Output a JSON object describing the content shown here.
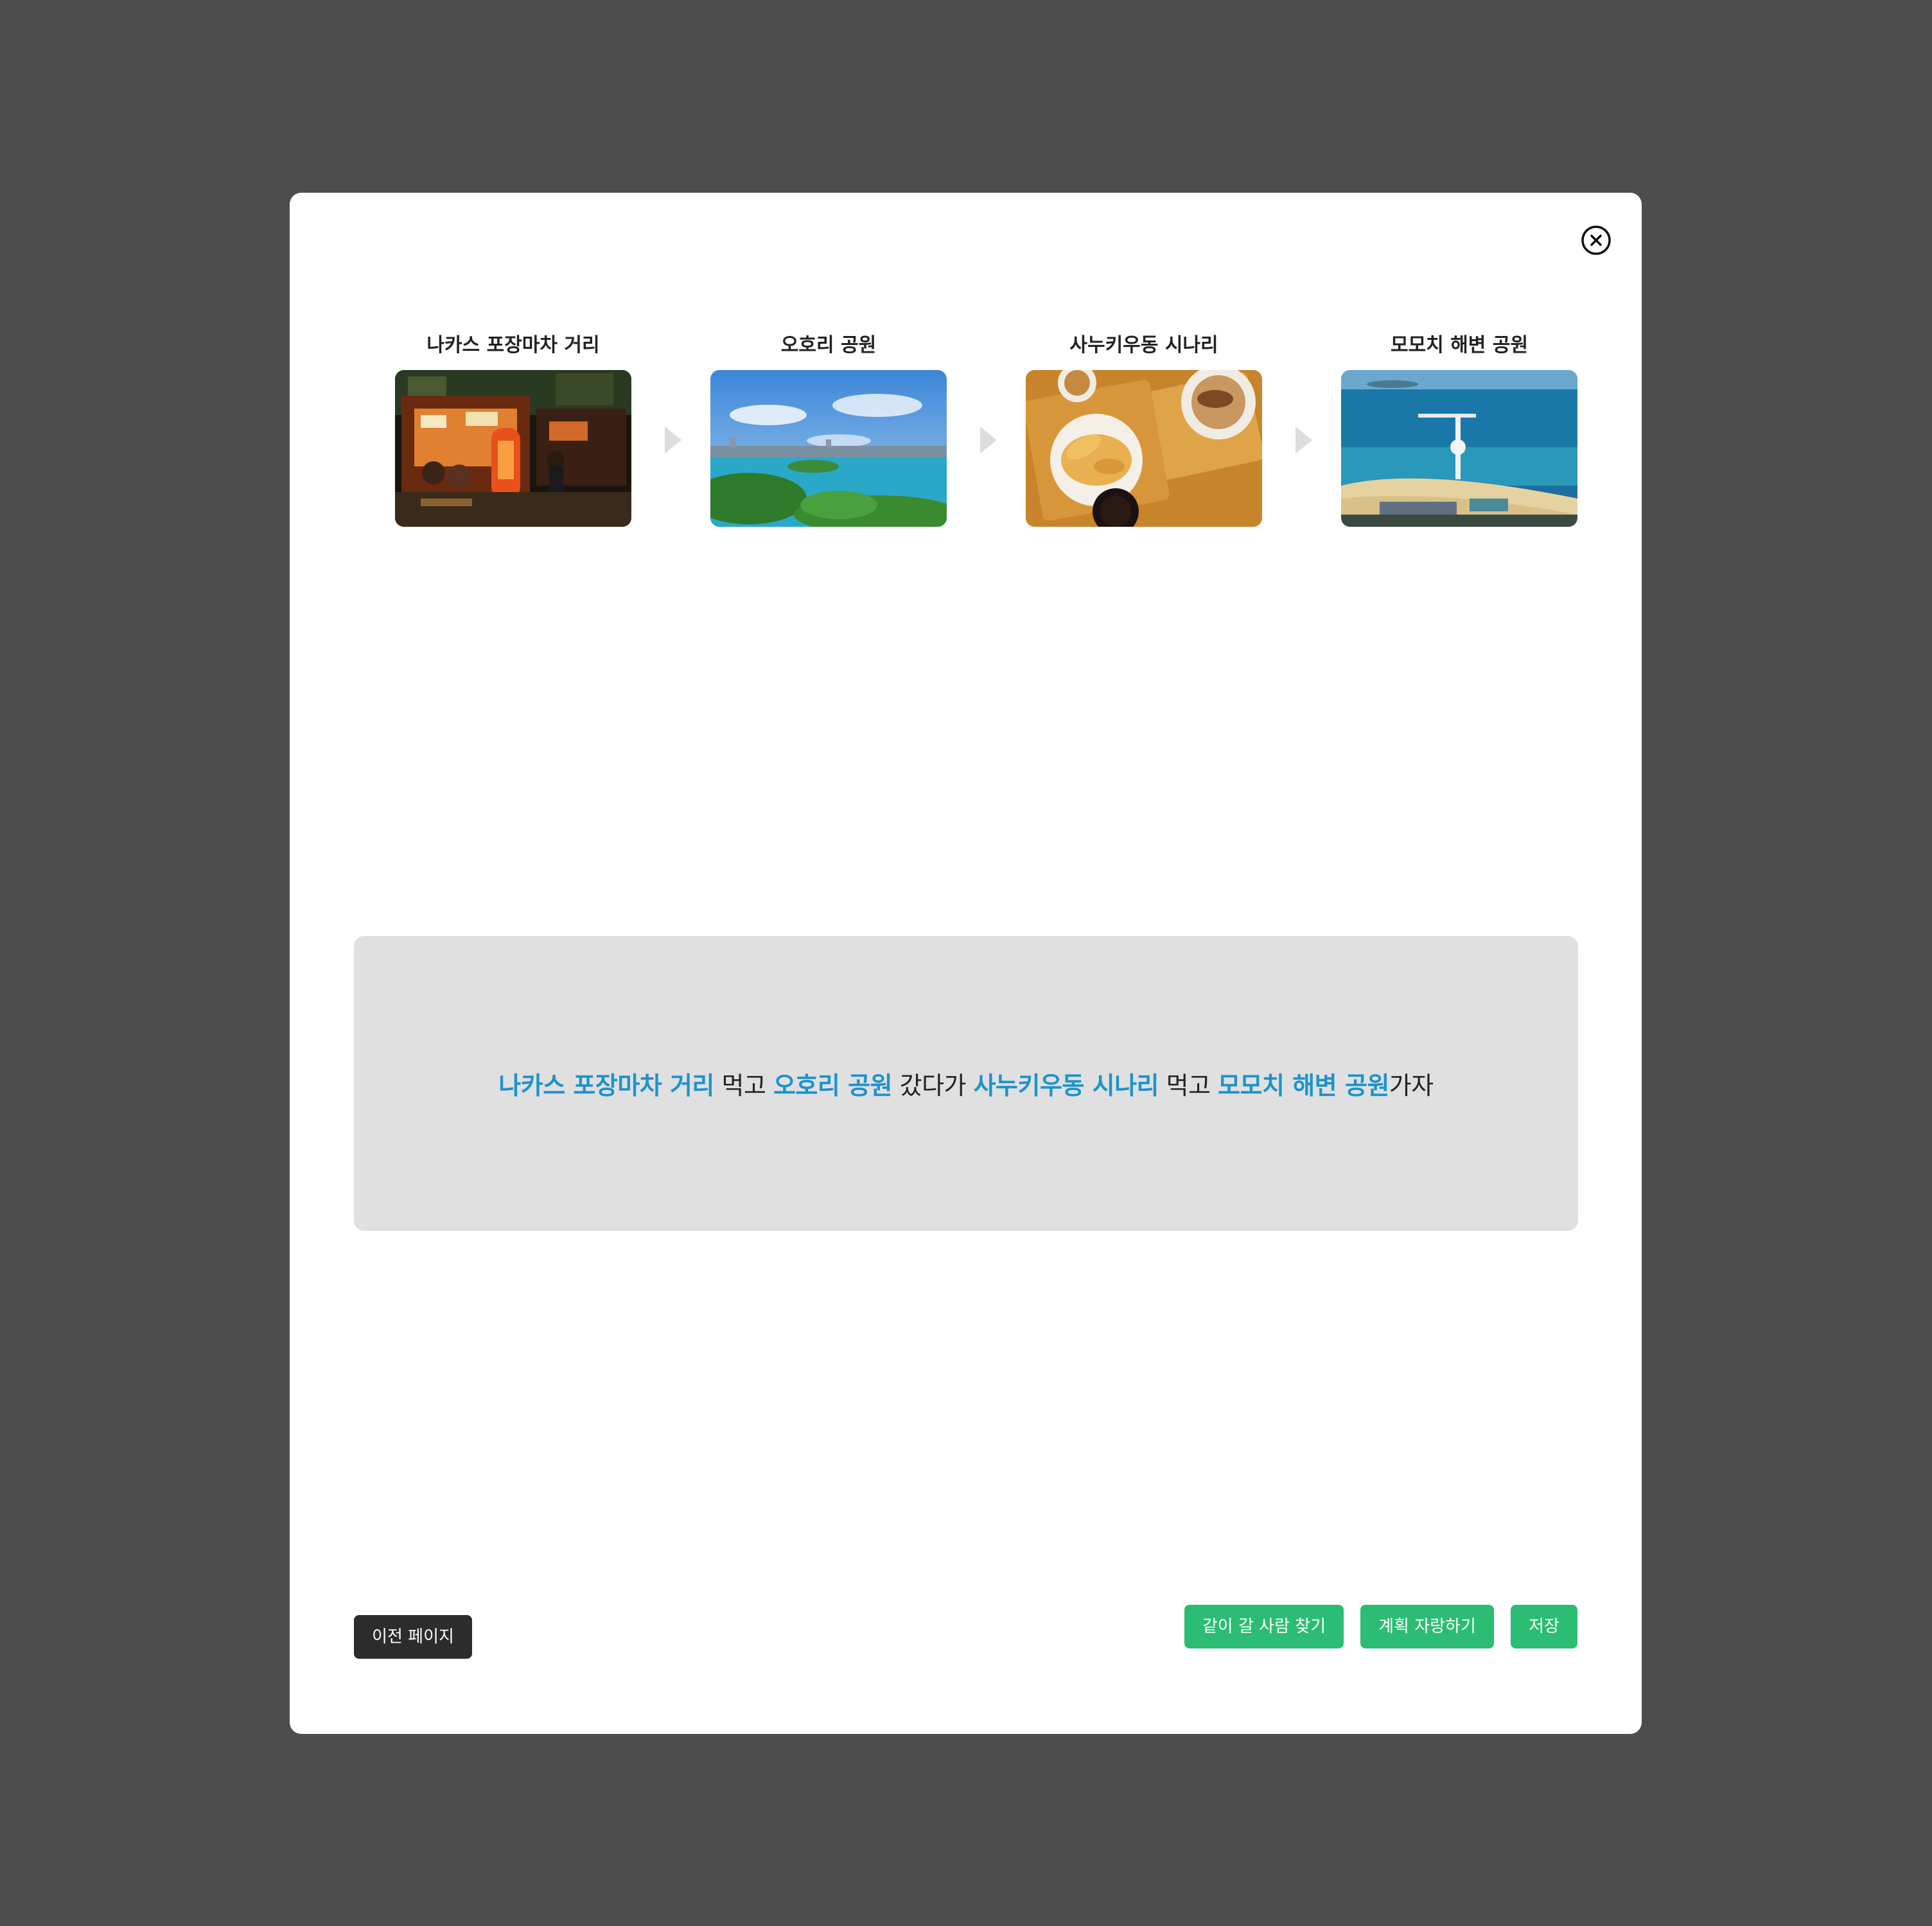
{
  "modal": {
    "close_icon": "close-circle-icon"
  },
  "route": {
    "stops": [
      {
        "name": "나카스 포장마차 거리",
        "photo": "night-food-stalls-photo"
      },
      {
        "name": "오호리 공원",
        "photo": "lake-park-photo"
      },
      {
        "name": "사누키우동 시나리",
        "photo": "udon-tempura-meal-photo"
      },
      {
        "name": "모모치 해변 공원",
        "photo": "beach-pier-photo"
      }
    ],
    "arrow_icon": "triangle-right-icon"
  },
  "summary": {
    "place1": "나카스 포장마차 거리",
    "verb1": " 먹고 ",
    "place2": "오호리 공원",
    "verb2": " 갔다가 ",
    "place3": "사누키우동 시나리",
    "verb3": " 먹고 ",
    "place4": "모모치 해변 공원",
    "verb4": "가자"
  },
  "buttons": {
    "prev_label": "이전 페이지",
    "find_companion_label": "같이 갈 사람 찾기",
    "show_off_label": "계획 자랑하기",
    "save_label": "저장"
  },
  "colors": {
    "backdrop": "#4d4d4d",
    "place_highlight": "#1c93cc",
    "action_green": "#2bbd73",
    "prev_dark": "#2c2c2c",
    "summary_bg": "#e0e0e0"
  }
}
